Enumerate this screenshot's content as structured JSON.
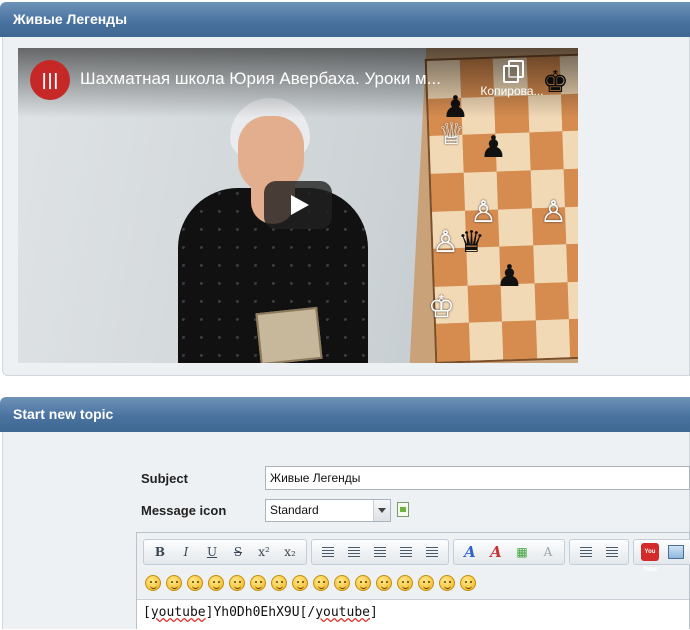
{
  "section1": {
    "title": "Живые Легенды"
  },
  "video": {
    "channel_logo_text": "|||",
    "title": "Шахматная школа Юрия Авербаха. Уроки м...",
    "copy_label": "Копирова..."
  },
  "section2": {
    "title": "Start new topic"
  },
  "form": {
    "subject_label": "Subject",
    "subject_value": "Живые Легенды",
    "message_icon_label": "Message icon",
    "message_icon_value": "Standard"
  },
  "editor": {
    "toolbar": {
      "bold": "B",
      "italic": "I",
      "underline": "U",
      "strike": "S",
      "superscript": "x²",
      "subscript": "x₂",
      "youtube": "You Tube"
    },
    "text_prefix": "[",
    "text_tag_open": "youtube",
    "text_middle": "]Yh0Dh0EhX9U[/",
    "text_tag_close": "youtube",
    "text_suffix": "]"
  }
}
